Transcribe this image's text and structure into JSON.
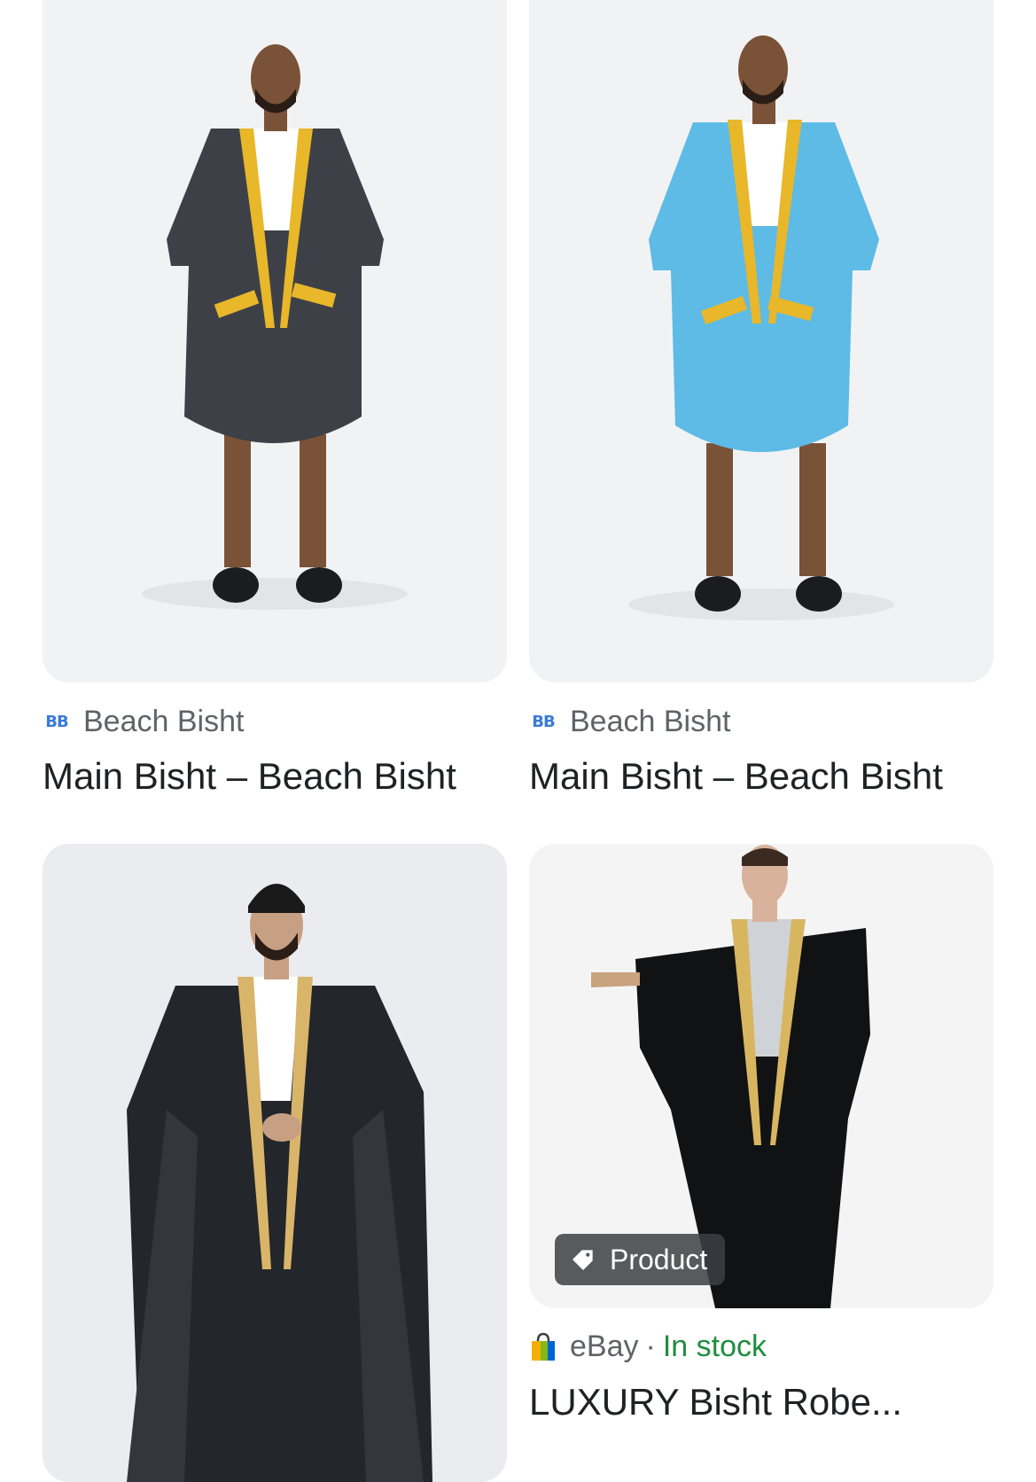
{
  "results": [
    {
      "source": "Beach Bisht",
      "favicon": "BB",
      "title": "Main Bisht – Beach Bisht",
      "image": "man-in-grey-bisht-with-yellow-trim",
      "robe_color": "#3d4147",
      "trim_color": "#e8b72a"
    },
    {
      "source": "Beach Bisht",
      "favicon": "BB",
      "title": "Main Bisht – Beach Bisht",
      "image": "man-in-light-blue-bisht-with-yellow-trim",
      "robe_color": "#5dbbe6",
      "trim_color": "#e8b72a"
    },
    {
      "image": "man-in-black-bisht-with-gold-trim-and-beanie",
      "robe_color": "#23262b",
      "trim_color": "#d9b56a"
    },
    {
      "source": "eBay",
      "availability": "In stock",
      "separator": "·",
      "badge": "Product",
      "badge_icon": "tag-icon",
      "title": "LUXURY Bisht Robe...",
      "image": "man-in-black-bisht-with-gold-trim-arm-extended",
      "robe_color": "#111214",
      "trim_color": "#d8b660"
    }
  ],
  "colors": {
    "source_text": "#5f6368",
    "title_text": "#202124",
    "in_stock": "#1e8e3e",
    "favicon_blue": "#3a7bd5"
  }
}
